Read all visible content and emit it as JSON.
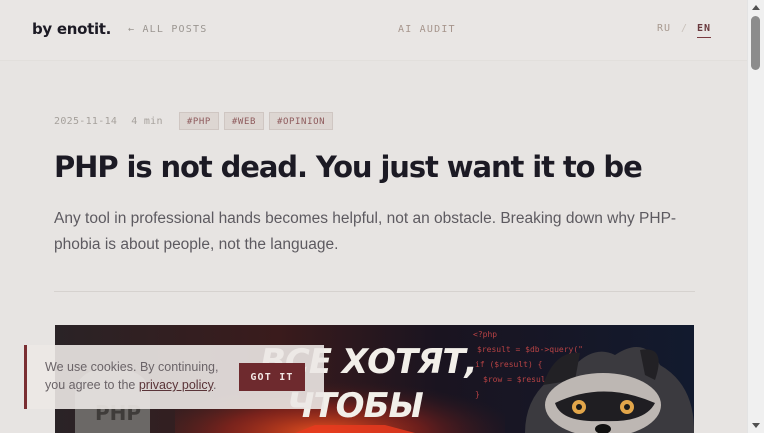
{
  "header": {
    "brand": "by enotit.",
    "all_posts": "← ALL POSTS",
    "ai_audit": "AI AUDIT",
    "lang_ru": "RU",
    "lang_separator": "/",
    "lang_en": "EN",
    "active_language": "EN"
  },
  "article": {
    "date": "2025-11-14",
    "read_time": "4 min",
    "tags": [
      "#PHP",
      "#WEB",
      "#OPINION"
    ],
    "title": "PHP is not dead. You just want it to be",
    "lead": "Any tool in professional hands becomes helpful, not an obstacle. Breaking down why PHP-phobia is about people, not the language.",
    "hero_text_line1": "ВСЕ ХОТЯТ,",
    "hero_text_line2": "ЧТОБЫ",
    "hero_tombstone_text": "PHP",
    "hero_code_lines": [
      "<?php",
      "$result = $db->query(\"",
      "if ($result) {",
      "  $row = $result",
      "}"
    ]
  },
  "cookie": {
    "text_before_link": "We use cookies. By continuing, you agree to the ",
    "link_text": "privacy policy",
    "text_after_link": ".",
    "button_label": "GOT IT"
  },
  "colors": {
    "background": "#e7e4e2",
    "accent": "#6e2a2e",
    "tag_text": "#8e5a5c",
    "title": "#1c1a24"
  }
}
